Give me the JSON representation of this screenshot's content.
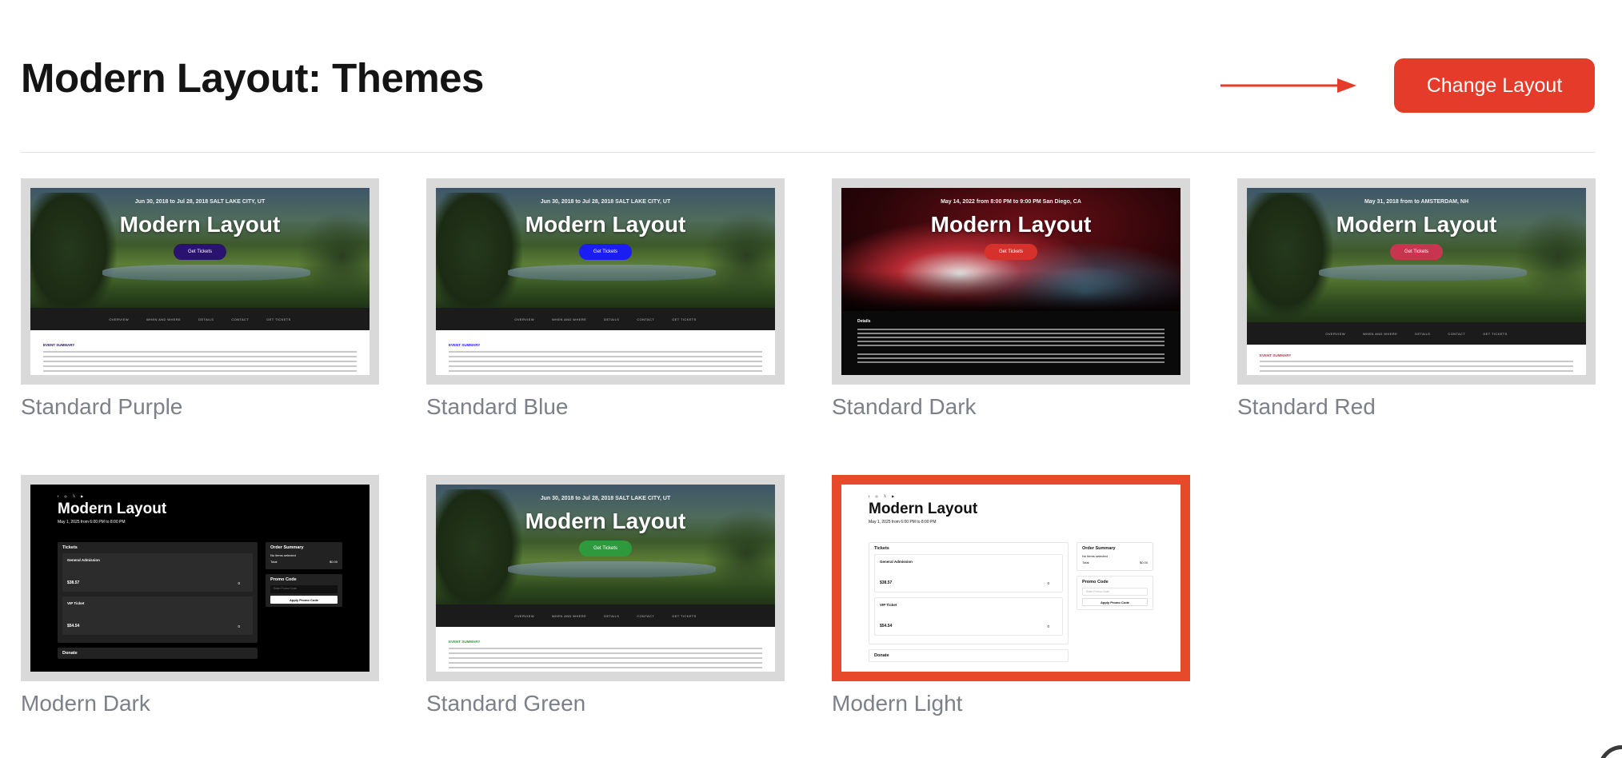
{
  "header": {
    "title": "Modern Layout: Themes",
    "change_layout_label": "Change Layout"
  },
  "colors": {
    "accent": "#e43b2a",
    "selected_border": "#e64a2b",
    "label_gray": "#7b8089"
  },
  "themes": [
    {
      "label": "Standard Purple",
      "style": "standard",
      "hero": "forest",
      "button_color": "#2a126f",
      "date": "Jun 30, 2018 to Jul 28, 2018   SALT LAKE CITY, UT",
      "title": "Modern Layout",
      "button": "Get Tickets",
      "nav": [
        "OVERVIEW",
        "WHEN AND WHERE",
        "DETAILS",
        "CONTACT",
        "GET TICKETS"
      ],
      "summary": "EVENT SUMMARY"
    },
    {
      "label": "Standard Blue",
      "style": "standard",
      "hero": "forest",
      "button_color": "#1b1ef2",
      "date": "Jun 30, 2018 to Jul 28, 2018   SALT LAKE CITY, UT",
      "title": "Modern Layout",
      "button": "Get Tickets",
      "nav": [
        "OVERVIEW",
        "WHEN AND WHERE",
        "DETAILS",
        "CONTACT",
        "GET TICKETS"
      ],
      "summary": "EVENT SUMMARY"
    },
    {
      "label": "Standard Dark",
      "style": "standard-dark",
      "hero": "concert",
      "button_color": "#d6322b",
      "date": "May 14, 2022 from 8:00 PM to 9:00 PM   San Diego, CA",
      "title": "Modern Layout",
      "button": "Get Tickets",
      "details": "Details"
    },
    {
      "label": "Standard Red",
      "style": "standard",
      "hero": "forest",
      "button_color": "#c8354f",
      "date": "May 31, 2018 from to   AMSTERDAM, NH",
      "title": "Modern Layout",
      "button": "Get Tickets",
      "nav": [
        "OVERVIEW",
        "WHEN AND WHERE",
        "DETAILS",
        "CONTACT",
        "GET TICKETS"
      ],
      "summary": "EVENT SUMMARY"
    },
    {
      "label": "Modern Dark",
      "style": "modern-dark"
    },
    {
      "label": "Standard Green",
      "style": "standard",
      "hero": "forest",
      "button_color": "#2e9a3d",
      "date": "Jun 30, 2018 to Jul 28, 2018   SALT LAKE CITY, UT",
      "title": "Modern Layout",
      "button": "Get Tickets",
      "nav": [
        "OVERVIEW",
        "WHEN AND WHERE",
        "DETAILS",
        "CONTACT",
        "GET TICKETS"
      ],
      "summary": "EVENT SUMMARY"
    },
    {
      "label": "Modern Light",
      "style": "modern-light",
      "selected": true
    }
  ],
  "modern": {
    "socials": "f ◎ 𝕏 ▶",
    "title": "Modern Layout",
    "subtitle": "May 1, 2025 from 6:00 PM to 8:00 PM",
    "tickets_heading": "Tickets",
    "tickets": [
      {
        "name": "General Admission",
        "price": "$38.57",
        "qty": "0"
      },
      {
        "name": "VIP Ticket",
        "price": "$54.54",
        "qty": "0"
      }
    ],
    "donate": "Donate",
    "order_summary": "Order Summary",
    "no_items": "No items selected",
    "total_label": "Total",
    "total_value": "$0.00",
    "promo_heading": "Promo Code",
    "promo_placeholder": "Enter Promo Code",
    "promo_button": "Apply Promo Code"
  }
}
